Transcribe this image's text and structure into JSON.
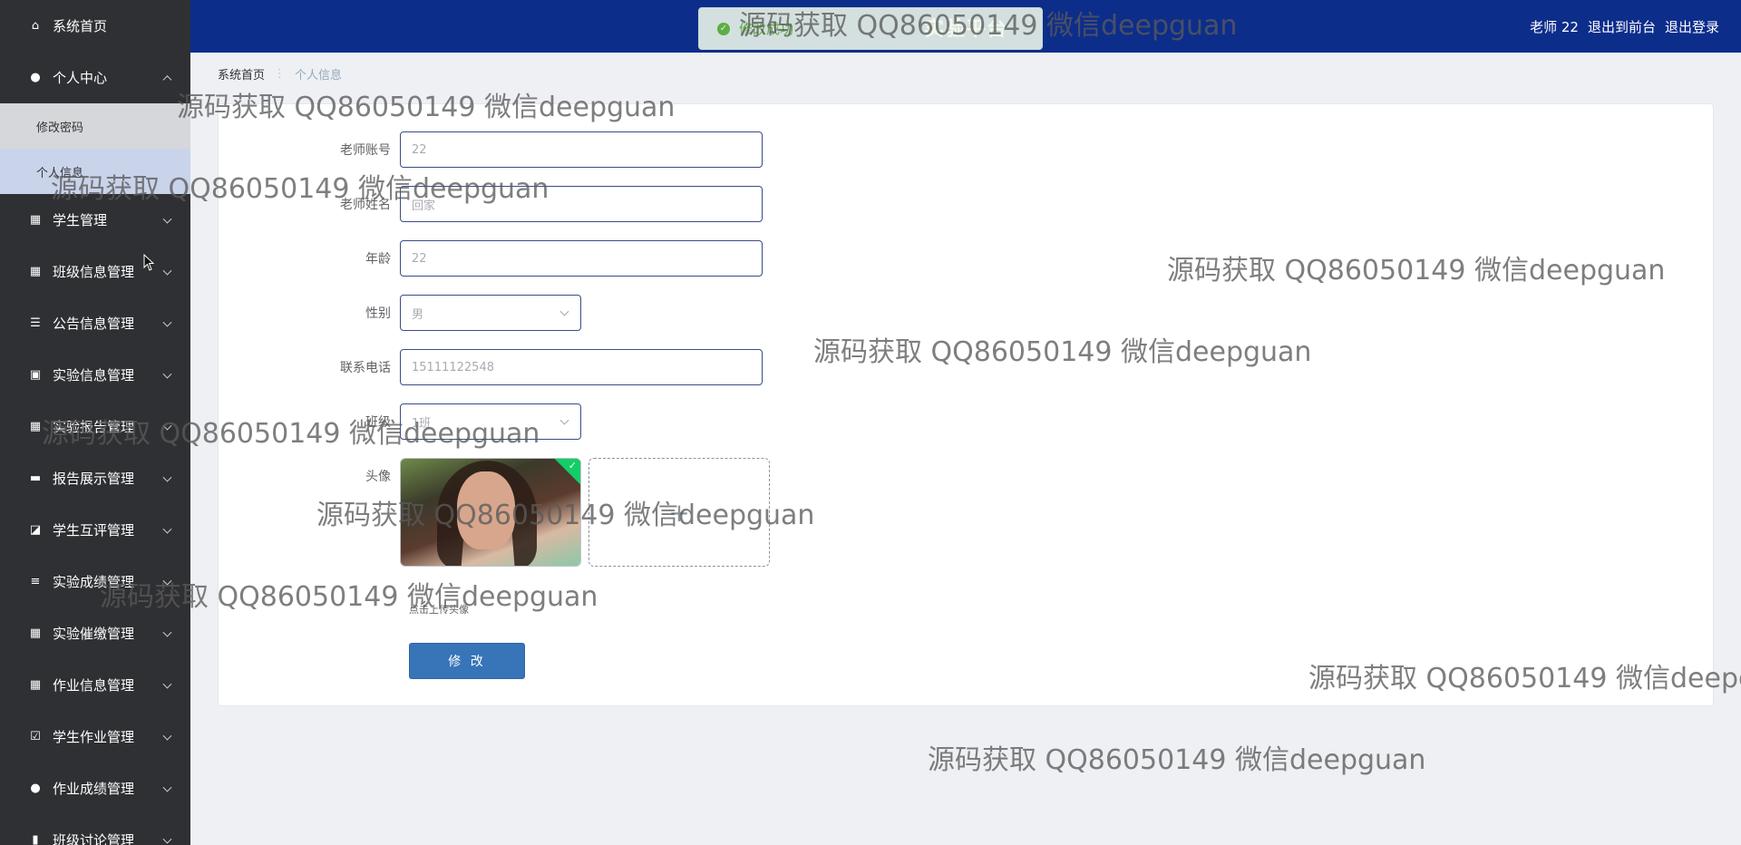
{
  "header": {
    "title": "实验平台",
    "user_label": "老师 22",
    "front_link": "退出到前台",
    "logout_link": "退出登录"
  },
  "toast": {
    "message": "修改成功"
  },
  "sidebar": {
    "items": [
      {
        "label": "系统首页",
        "icon": "home-icon"
      },
      {
        "label": "个人中心",
        "icon": "user-icon",
        "expanded": true,
        "children": [
          "修改密码",
          "个人信息"
        ]
      },
      {
        "label": "学生管理",
        "icon": "grid-icon"
      },
      {
        "label": "班级信息管理",
        "icon": "grid-icon"
      },
      {
        "label": "公告信息管理",
        "icon": "sliders-icon"
      },
      {
        "label": "实验信息管理",
        "icon": "clipboard-icon"
      },
      {
        "label": "实验报告管理",
        "icon": "grid-icon"
      },
      {
        "label": "报告展示管理",
        "icon": "monitor-icon"
      },
      {
        "label": "学生互评管理",
        "icon": "chart-icon"
      },
      {
        "label": "实验成绩管理",
        "icon": "list-icon"
      },
      {
        "label": "实验催缴管理",
        "icon": "grid-icon"
      },
      {
        "label": "作业信息管理",
        "icon": "grid-icon"
      },
      {
        "label": "学生作业管理",
        "icon": "check-clipboard-icon"
      },
      {
        "label": "作业成绩管理",
        "icon": "user-icon"
      },
      {
        "label": "班级讨论管理",
        "icon": "book-icon"
      }
    ]
  },
  "breadcrumb": {
    "home": "系统首页",
    "current": "个人信息"
  },
  "form": {
    "account_label": "老师账号",
    "account_value": "22",
    "name_label": "老师姓名",
    "name_value": "回家",
    "age_label": "年龄",
    "age_value": "22",
    "gender_label": "性别",
    "gender_value": "男",
    "phone_label": "联系电话",
    "phone_value": "15111122548",
    "class_label": "班级",
    "class_value": "1班",
    "avatar_label": "头像",
    "upload_plus": "+",
    "upload_tip": "点击上传头像",
    "submit_label": "修 改"
  },
  "watermark": "源码获取 QQ86050149 微信deepguan"
}
